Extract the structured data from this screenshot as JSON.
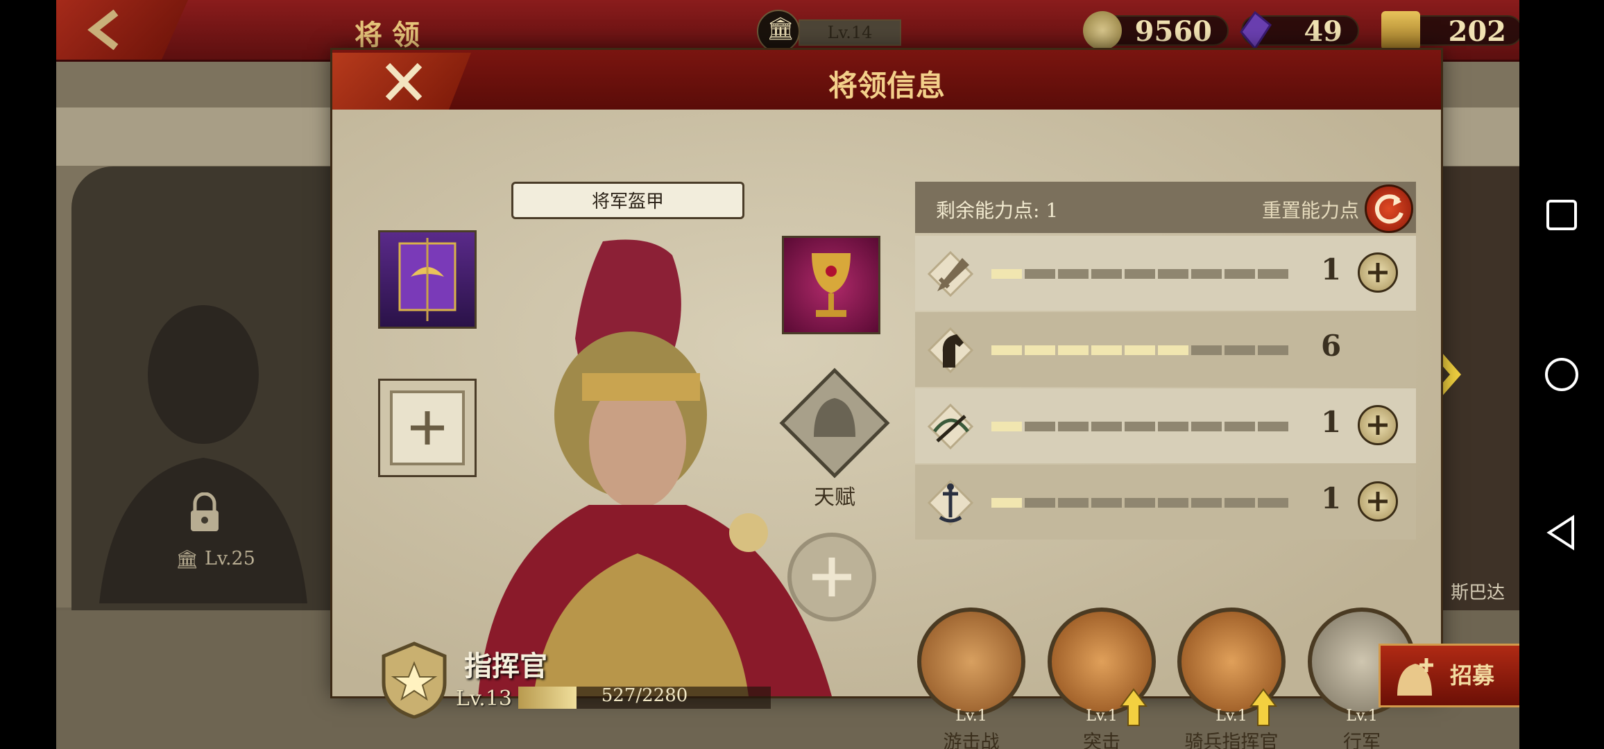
{
  "top_bar": {
    "title": "将领",
    "building_level": "Lv.14",
    "resources": [
      {
        "icon": "coin-icon",
        "value": "9560"
      },
      {
        "icon": "gem-icon",
        "value": "49"
      },
      {
        "icon": "spqr-token-icon",
        "value": "202"
      }
    ]
  },
  "background": {
    "locked_slot_level": "Lv.25",
    "right_hero_name_partial": "斯巴达"
  },
  "modal": {
    "title": "将领信息",
    "armor_label": "将军盔甲",
    "talent_label": "天赋",
    "stats": {
      "remaining_label": "剩余能力点: 1",
      "reset_label": "重置能力点",
      "rows": [
        {
          "icon": "sword-icon",
          "value": "1",
          "fill": 1,
          "max": 9,
          "has_plus": true
        },
        {
          "icon": "horse-icon",
          "value": "6",
          "fill": 6,
          "max": 9,
          "has_plus": false
        },
        {
          "icon": "crossbow-icon",
          "value": "1",
          "fill": 1,
          "max": 9,
          "has_plus": true
        },
        {
          "icon": "anchor-icon",
          "value": "1",
          "fill": 1,
          "max": 9,
          "has_plus": true
        }
      ]
    },
    "skills": [
      {
        "name": "游击战",
        "level": "Lv.1",
        "upgradable": false
      },
      {
        "name": "突击",
        "level": "Lv.1",
        "upgradable": true
      },
      {
        "name": "骑兵指挥官",
        "level": "Lv.1",
        "upgradable": true
      },
      {
        "name": "行军",
        "level": "Lv.1",
        "upgradable": false
      }
    ],
    "hero": {
      "rank": "指挥官",
      "level": "Lv.13",
      "xp_text": "527/2280",
      "xp_current": 527,
      "xp_max": 2280
    }
  },
  "recruit_label": "招募",
  "colors": {
    "accent_red": "#8a1c1c",
    "gold": "#f3d08a",
    "bar_fill": "#f1e6b0"
  }
}
